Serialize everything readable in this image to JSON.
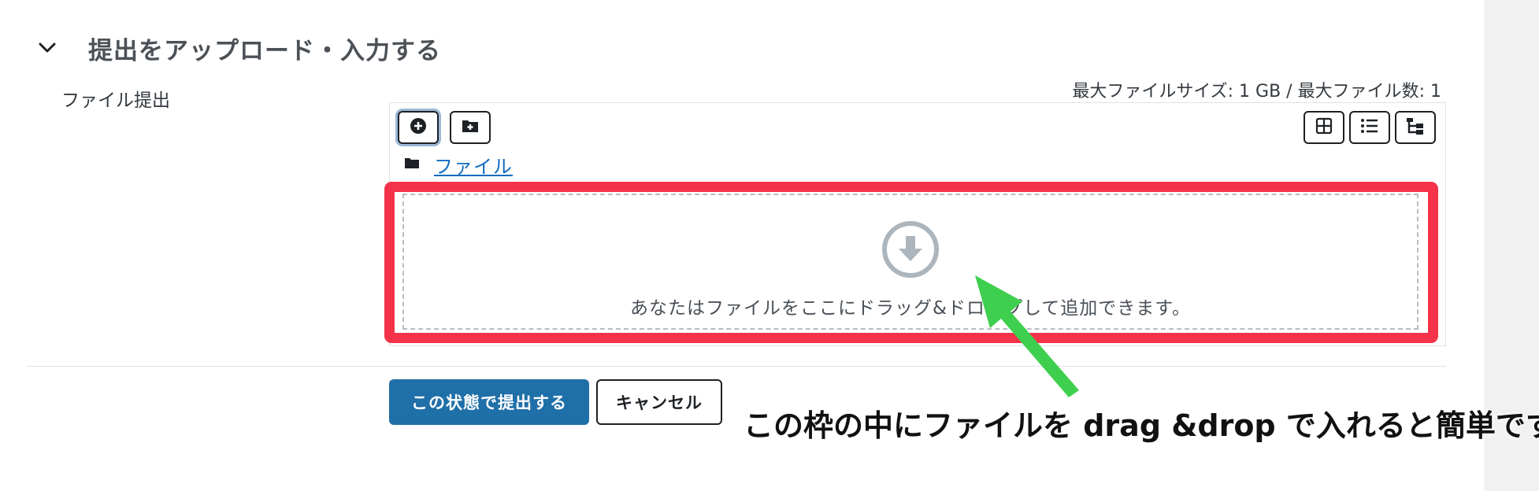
{
  "section": {
    "title": "提出をアップロード・入力する",
    "chevron_icon": "chevron-down-icon"
  },
  "field": {
    "label": "ファイル提出"
  },
  "limits": {
    "text": "最大ファイルサイズ: 1 GB / 最大ファイル数: 1"
  },
  "toolbar": {
    "left_buttons": [
      {
        "name": "add-file-button",
        "icon": "plus-circle-icon",
        "focused": true
      },
      {
        "name": "create-folder-button",
        "icon": "folder-plus-icon"
      }
    ],
    "view_buttons": [
      {
        "name": "view-icons-button",
        "icon": "grid-icon"
      },
      {
        "name": "view-details-button",
        "icon": "list-icon"
      },
      {
        "name": "view-tree-button",
        "icon": "tree-icon"
      }
    ]
  },
  "path": {
    "folder_icon": "folder-icon",
    "link_text": "ファイル"
  },
  "dropzone": {
    "icon": "download-arrow-icon",
    "text": "あなたはファイルをここにドラッグ&ドロップして追加できます。"
  },
  "actions": {
    "submit_label": "この状態で提出する",
    "cancel_label": "キャンセル"
  },
  "annotation": {
    "text": "この枠の中にファイルを drag &drop で入れると簡単です。"
  },
  "colors": {
    "highlight": "#f4334a",
    "arrow": "#3fcf4f",
    "primary": "#1f6fa8",
    "link": "#0f6cbf"
  }
}
